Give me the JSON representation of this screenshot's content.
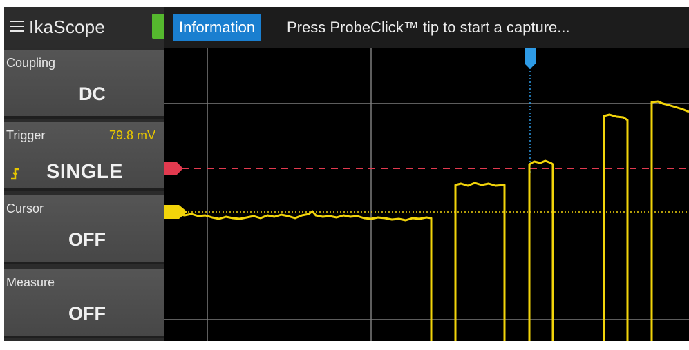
{
  "app": {
    "title": "IkaScope",
    "menu_icon": "hamburger-menu-icon",
    "status_color": "#55b82e"
  },
  "info": {
    "badge": "Information",
    "message": "Press ProbeClick™ tip to start a capture...",
    "badge_color": "#1a7fd0"
  },
  "panels": {
    "coupling": {
      "label": "Coupling",
      "value": "DC"
    },
    "trigger": {
      "label": "Trigger",
      "level": "79.8 mV",
      "mode": "SINGLE",
      "icon": "rising-edge-icon",
      "level_color": "#e8c800"
    },
    "cursor": {
      "label": "Cursor",
      "value": "OFF"
    },
    "measure": {
      "label": "Measure",
      "value": "OFF"
    }
  },
  "plot": {
    "background": "#000000",
    "trace_color": "#f2d40a",
    "trigger_line_color": "#e23a4f",
    "cursor_color": "#2e9be6",
    "grid_color": "#8a8a8a"
  }
}
